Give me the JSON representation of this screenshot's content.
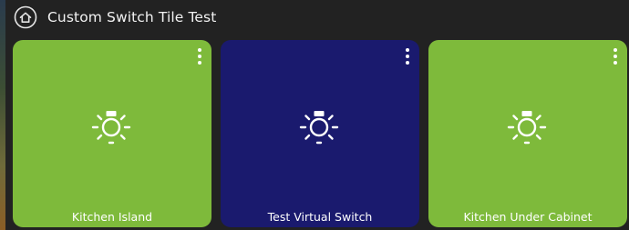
{
  "header": {
    "title": "Custom Switch Tile Test",
    "icon": "home-icon"
  },
  "tiles": [
    {
      "label": "Kitchen Island",
      "color": "#7eba3b",
      "icon": "lightbulb-icon",
      "menu_icon": "more-vertical-icon"
    },
    {
      "label": "Test Virtual Switch",
      "color": "#1a1a6e",
      "icon": "lightbulb-icon",
      "menu_icon": "more-vertical-icon"
    },
    {
      "label": "Kitchen Under Cabinet",
      "color": "#7eba3b",
      "icon": "lightbulb-icon",
      "menu_icon": "more-vertical-icon"
    }
  ]
}
